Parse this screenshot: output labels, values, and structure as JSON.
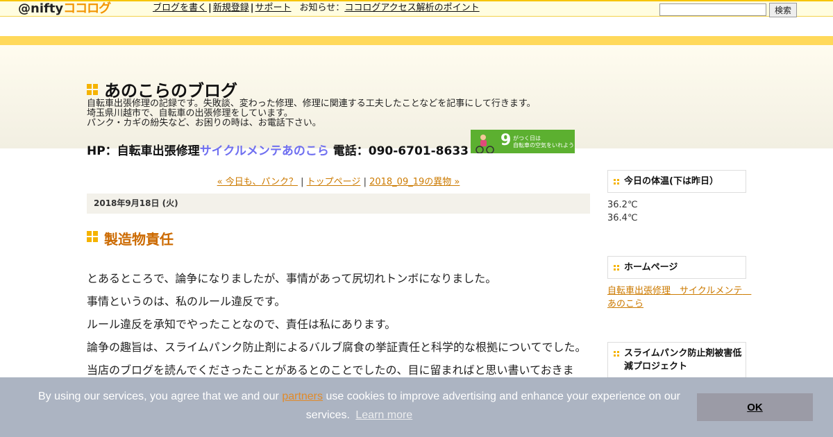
{
  "topbar": {
    "logo_prefix": "@nifty",
    "logo_brand": "ココログ",
    "nav": [
      {
        "label": "ブログを書く"
      },
      {
        "label": "新規登録"
      },
      {
        "label": "サポート"
      }
    ],
    "notice_label": "お知らせ",
    "notice_link": "ココログアクセス解析のポイント",
    "search_placeholder": "",
    "search_button": "検索"
  },
  "blog": {
    "title": "あのこらのブログ",
    "description": [
      "自転車出張修理の記録です。失敗談、変わった修理、修理に関連する工夫したことなどを記事にして行きます。",
      "埼玉県川越市で、自転車の出張修理をしています。",
      "パンク・カギの紛失など、お困りの時は、お電話下さい。"
    ],
    "hp_prefix": "HP：自転車出張修理",
    "hp_link": "サイクルメンテあのこら",
    "phone": "電話：090-6701-8633",
    "banner_number": "9",
    "banner_line1": "がつく日は",
    "banner_line2": "自転車の空気をいれよう!"
  },
  "entry_nav": {
    "prev": "« 今日も、パンク？",
    "top": "トップページ",
    "next": "2018_09_19の異物 »",
    "sep": "|"
  },
  "entry": {
    "date": "2018年9月18日 (火)",
    "title": "製造物責任",
    "paragraphs": [
      "とあるところで、論争になりましたが、事情があって尻切れトンボになりました。",
      "事情というのは、私のルール違反です。",
      "ルール違反を承知でやったことなので、責任は私にあります。",
      "論争の趣旨は、スライムパンク防止剤によるバルブ腐食の挙証責任と科学的な根拠についてでした。",
      "当店のブログを読んでくださったことがあるとのことでしたの、目に留まればと思い書いておきま"
    ]
  },
  "sidebar": {
    "temp_title": "今日の体温(下は昨日）",
    "temps": [
      "36.2℃",
      "36.4℃"
    ],
    "home_title": "ホームページ",
    "home_link": "自転車出張修理　サイクルメンテ　あのこら",
    "project_title": "スライムパンク防止剤被害低減プロジェクト"
  },
  "cookie": {
    "text_before": "By using our services, you agree that we and our ",
    "partners": "partners",
    "text_after": " use cookies to improve advertising and enhance your experience on our services.",
    "learn_more": "Learn more",
    "ok": "OK"
  },
  "colors": {
    "accent_yellow": "#f5b300",
    "link_orange": "#cc7a00",
    "title_orange": "#cc6a00",
    "hp_link_blue": "#6f6ff0",
    "banner_green": "#5cb030"
  }
}
